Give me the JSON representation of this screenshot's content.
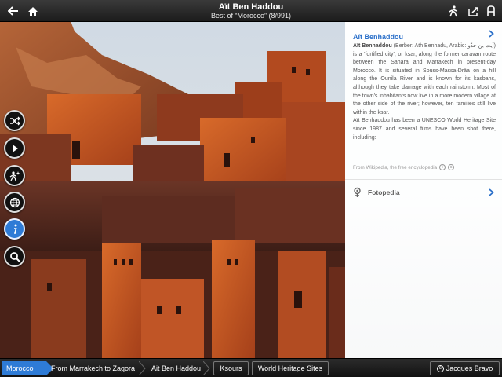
{
  "topbar": {
    "title": "Aït Ben Haddou",
    "subtitle": "Best of “Morocco” (8/991)",
    "icons": [
      "back-arrow-icon",
      "home-icon",
      "walking-person-icon",
      "share-icon",
      "text-size-icon"
    ]
  },
  "side_buttons": [
    "shuffle-icon",
    "play-icon",
    "person-sparkle-icon",
    "globe-icon",
    "info-icon",
    "search-icon"
  ],
  "panel": {
    "title": "Aït Benhaddou",
    "body_intro_bold": "Aït Benhaddou",
    "body_intro_rest": " (Berber: Ath Benhadu, Arabic: آيت بن حدّو) is a 'fortified city', or ksar, along the former caravan route between the Sahara and Marrakech in present-day Morocco. It is situated in Souss-Massa-Drâa on a hill along the Ounila River and is known for its kasbahs, although they take damage with each rainstorm. Most of the town's inhabitants now live in a more modern village at the other side of the river; however, ten families still live within the ksar.",
    "body_second": "Aït Benhaddou has been a UNESCO World Heritage Site since 1987 and several films have been shot there, including:",
    "source": "From Wikipedia, the free encyclopedia",
    "fotopedia_label": "Fotopedia"
  },
  "breadcrumb": [
    "Morocco",
    "From Marrakech to Zagora",
    "Ait Ben Haddou"
  ],
  "tags": [
    "Ksours",
    "World Heritage Sites"
  ],
  "credit": "Jacques Bravo",
  "colors": {
    "accent": "#2e7bd6",
    "panel_title": "#2a6fc9"
  }
}
